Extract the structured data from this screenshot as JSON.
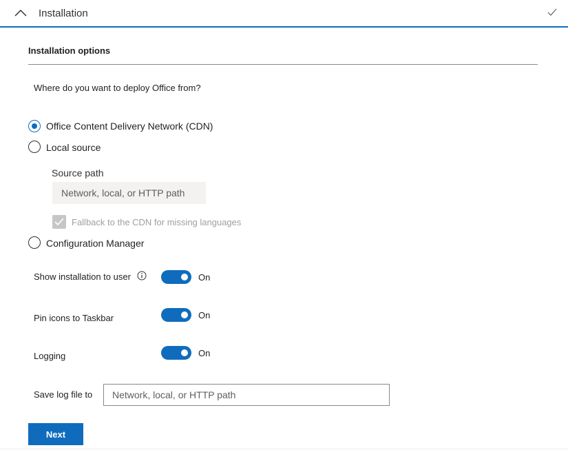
{
  "header": {
    "title": "Installation",
    "collapse_icon": "chevron-up-icon",
    "status_icon": "check-icon"
  },
  "section": {
    "title": "Installation options"
  },
  "deploy": {
    "question": "Where do you want to deploy Office from?",
    "options": [
      {
        "label": "Office Content Delivery Network (CDN)",
        "checked": true
      },
      {
        "label": "Local source",
        "checked": false
      },
      {
        "label": "Configuration Manager",
        "checked": false
      }
    ],
    "source_path": {
      "label": "Source path",
      "placeholder": "Network, local, or HTTP path",
      "fallback_label": "Fallback to the CDN for missing languages",
      "fallback_checked": true
    }
  },
  "settings": {
    "show_installation": {
      "label": "Show installation to user",
      "state": "On"
    },
    "pin_icons": {
      "label": "Pin icons to Taskbar",
      "state": "On"
    },
    "logging": {
      "label": "Logging",
      "state": "On"
    },
    "save_log": {
      "label": "Save log file to",
      "placeholder": "Network, local, or HTTP path"
    }
  },
  "actions": {
    "next_label": "Next"
  },
  "colors": {
    "accent": "#0f6cbd",
    "disabled": "#c8c6c4"
  }
}
